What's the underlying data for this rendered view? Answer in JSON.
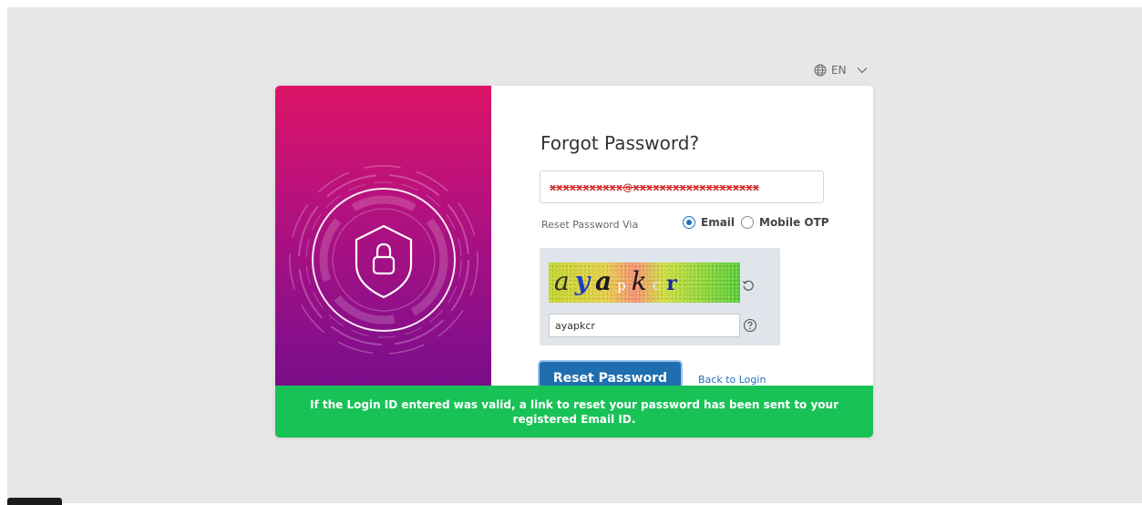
{
  "language": {
    "code": "EN"
  },
  "form": {
    "title": "Forgot Password?",
    "email_value": "xxxxxxxxxxx@xxxxxxxxxxxxxxxxxxx",
    "reset_via_label": "Reset Password Via",
    "options": [
      {
        "label": "Email",
        "selected": true
      },
      {
        "label": "Mobile OTP",
        "selected": false
      }
    ],
    "captcha": {
      "chars": [
        "a",
        "y",
        "a",
        "p",
        "k",
        "c",
        "r"
      ],
      "input_value": "ayapkcr"
    },
    "reset_button": "Reset Password",
    "back_link": "Back to Login"
  },
  "toast": {
    "message": "If the Login ID entered was valid, a link to reset your password has been sent to your registered Email ID."
  },
  "colors": {
    "primary": "#1f6fb0",
    "success": "#19c257",
    "hero_top": "#dc1466",
    "hero_bottom": "#6a0a88"
  },
  "icons": [
    "globe-icon",
    "chevron-down-icon",
    "shield-lock-icon",
    "refresh-icon",
    "help-icon"
  ]
}
